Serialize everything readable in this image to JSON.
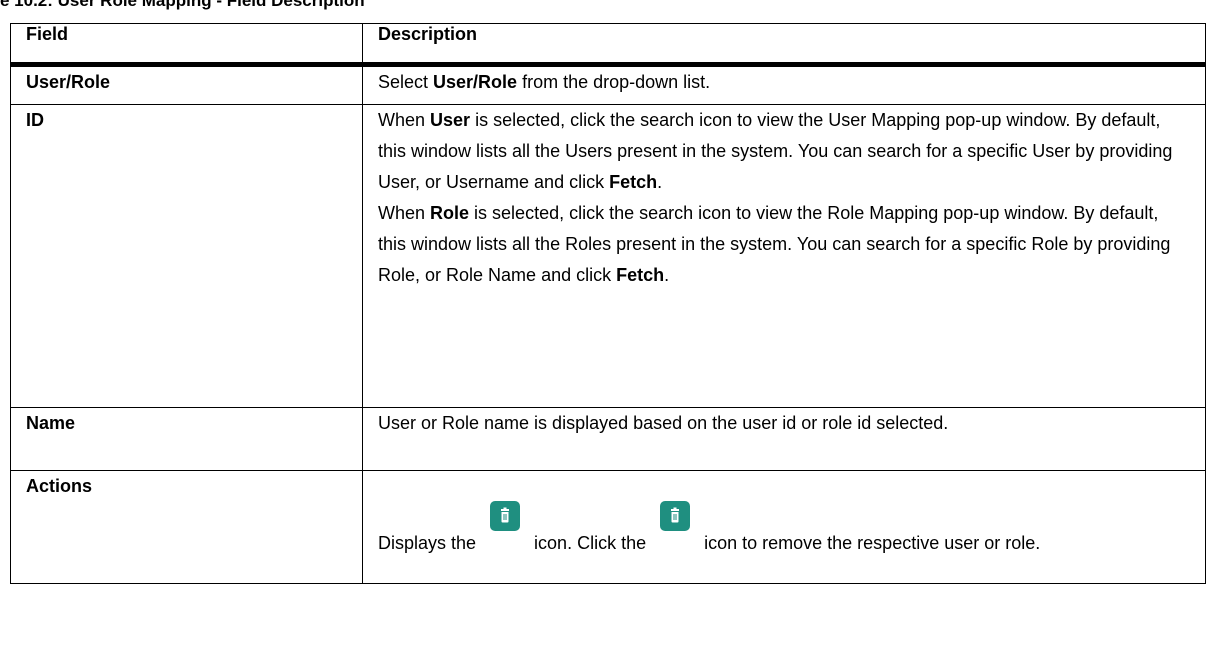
{
  "caption": "e 10.2:   User Role Mapping - Field Description",
  "header": {
    "field": "Field",
    "description": "Description"
  },
  "rows": [
    {
      "field": "User/Role",
      "desc": {
        "a": "Select ",
        "b": "User/Role",
        "c": " from the drop-down list."
      }
    },
    {
      "field": "ID",
      "p1": {
        "a": "When ",
        "b": "User",
        "c": " is selected, click the search icon to view the User Mapping pop-up window. By default, this window lists all the Users present in the system. You can search for a specific User by providing User, or Username and click ",
        "d": "Fetch",
        "e": "."
      },
      "p2": {
        "a": "When ",
        "b": "Role",
        "c": " is selected, click the search icon to view the Role Mapping pop-up window. By default, this window lists all the Roles present in the system. You can search for a specific Role by providing Role, or Role Name and click ",
        "d": "Fetch",
        "e": "."
      }
    },
    {
      "field": "Name",
      "desc": "User or Role name is displayed based on the user id or role id selected."
    },
    {
      "field": "Actions",
      "desc": {
        "a": "Displays the",
        "b": "icon. Click the",
        "c": "icon to remove the respective user or role."
      },
      "icon": "trash-icon",
      "icon_color": "#1f8f80"
    }
  ]
}
